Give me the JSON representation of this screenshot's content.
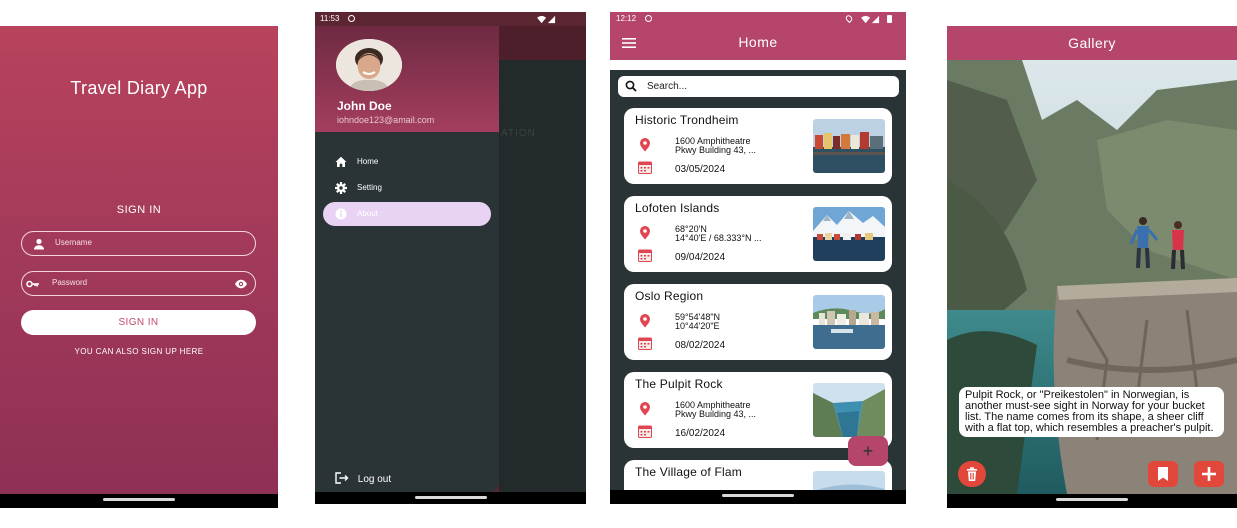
{
  "login": {
    "app_title": "Travel Diary App",
    "heading": "SIGN IN",
    "username_placeholder": "Username",
    "password_placeholder": "Password",
    "signin_button": "SIGN IN",
    "signup_text": "YOU CAN ALSO SIGN UP HERE",
    "colors": {
      "gradient_top": "#b8435c",
      "gradient_bottom": "#8e2f55",
      "button_text": "#c34a6a"
    },
    "icons": {
      "username": "person-icon",
      "password": "key-icon",
      "toggle": "eye-icon"
    }
  },
  "drawer": {
    "status_time": "11:53",
    "user": {
      "name": "John Doe",
      "email": "iohndoe123@amail.com"
    },
    "items": [
      {
        "label": "Home",
        "icon": "home-icon"
      },
      {
        "label": "Setting",
        "icon": "gear-icon"
      },
      {
        "label": "About",
        "icon": "info-icon",
        "active": true
      }
    ],
    "logout_label": "Log out",
    "underlay_text": "ATION",
    "colors": {
      "drawer_bg": "#2a3336",
      "active_item": "#e8d3f4"
    }
  },
  "home": {
    "status_time": "12:12",
    "title": "Home",
    "search_placeholder": "Search...",
    "cards": [
      {
        "title": "Historic Trondheim",
        "address_line1": "1600 Amphitheatre",
        "address_line2": "Pkwy Building 43, ...",
        "date": "03/05/2024",
        "thumb": "wharf-houses"
      },
      {
        "title": "Lofoten Islands",
        "address_line1": "68°20'N",
        "address_line2": "14°40'E / 68.333°N ...",
        "date": "09/04/2024",
        "thumb": "snowy-harbour"
      },
      {
        "title": "Oslo Region",
        "address_line1": "59°54'48\"N",
        "address_line2": "10°44'20\"E",
        "date": "08/02/2024",
        "thumb": "city-waterfront"
      },
      {
        "title": "The Pulpit Rock",
        "address_line1": "1600 Amphitheatre",
        "address_line2": "Pkwy Building 43, ...",
        "date": "16/02/2024",
        "thumb": "fjord"
      },
      {
        "title": "The Village of Flam",
        "address_line1": "",
        "address_line2": "",
        "date": "",
        "thumb": "sky"
      }
    ],
    "fab_label": "+",
    "colors": {
      "appbar": "#b5456a",
      "body": "#2a3336",
      "pin": "#e0464f"
    }
  },
  "gallery": {
    "title": "Gallery",
    "caption": "Pulpit Rock, or \"Preikestolen\" in Norwegian, is another must-see sight in Norway for your bucket list. The name comes from its shape, a sheer cliff with a flat top, which resembles a preacher's pulpit.",
    "buttons": {
      "delete": "trash-icon",
      "bookmark": "bookmark-icon",
      "add": "plus-icon"
    },
    "colors": {
      "appbar": "#b5456a",
      "action_red": "#e2473c"
    }
  }
}
